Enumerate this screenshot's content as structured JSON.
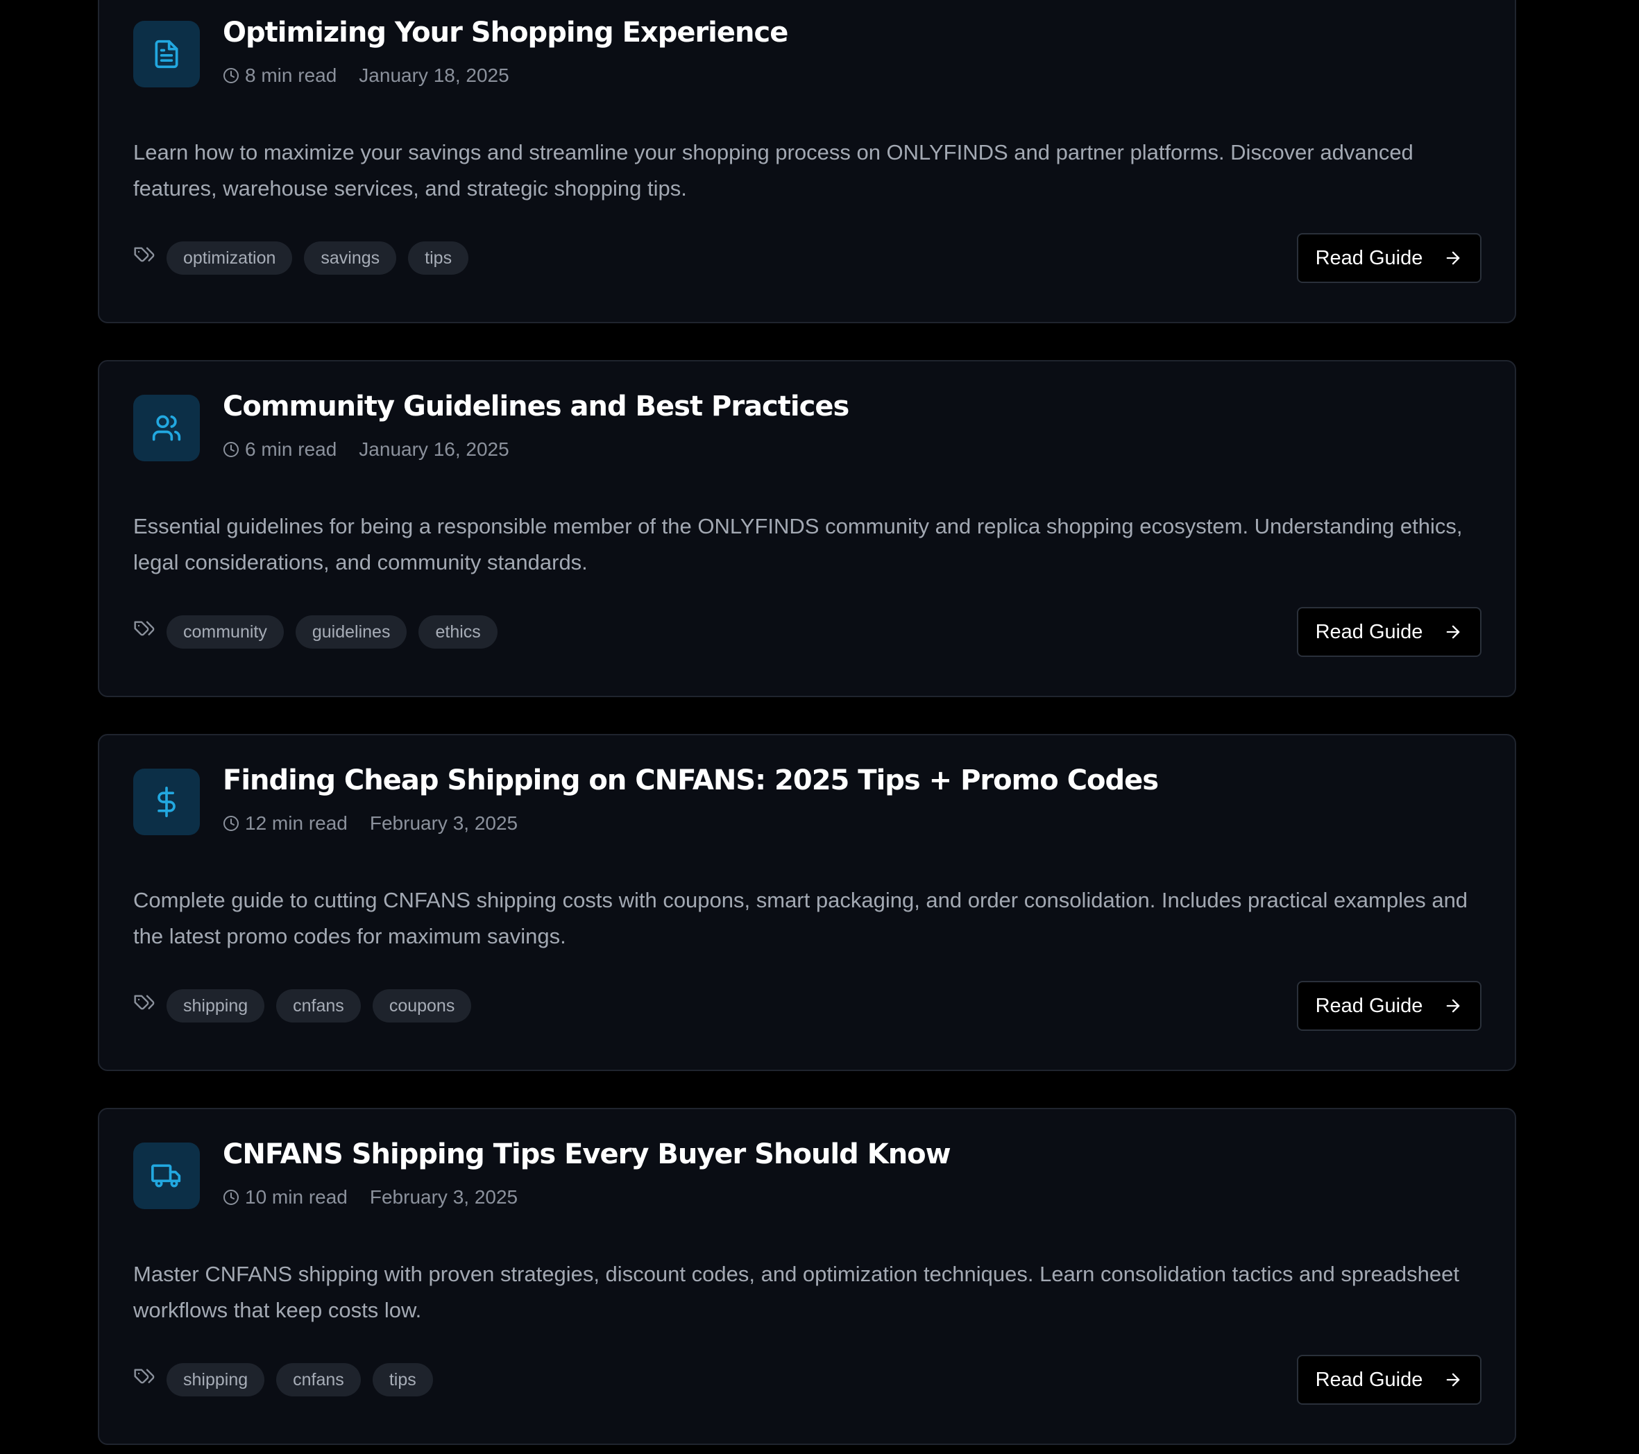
{
  "theme": {
    "accent": "#22a8e0",
    "card_bg": "#0a0d14",
    "page_bg": "#000000"
  },
  "guides": [
    {
      "icon": "document-icon",
      "title": "Optimizing Your Shopping Experience",
      "read_time": "8 min read",
      "date": "January 18, 2025",
      "description": "Learn how to maximize your savings and streamline your shopping process on ONLYFINDS and partner platforms. Discover advanced features, warehouse services, and strategic shopping tips.",
      "tags": [
        "optimization",
        "savings",
        "tips"
      ],
      "button_label": "Read Guide"
    },
    {
      "icon": "users-icon",
      "title": "Community Guidelines and Best Practices",
      "read_time": "6 min read",
      "date": "January 16, 2025",
      "description": "Essential guidelines for being a responsible member of the ONLYFINDS community and replica shopping ecosystem. Understanding ethics, legal considerations, and community standards.",
      "tags": [
        "community",
        "guidelines",
        "ethics"
      ],
      "button_label": "Read Guide"
    },
    {
      "icon": "dollar-icon",
      "title": "Finding Cheap Shipping on CNFANS: 2025 Tips + Promo Codes",
      "read_time": "12 min read",
      "date": "February 3, 2025",
      "description": "Complete guide to cutting CNFANS shipping costs with coupons, smart packaging, and order consolidation. Includes practical examples and the latest promo codes for maximum savings.",
      "tags": [
        "shipping",
        "cnfans",
        "coupons"
      ],
      "button_label": "Read Guide"
    },
    {
      "icon": "truck-icon",
      "title": "CNFANS Shipping Tips Every Buyer Should Know",
      "read_time": "10 min read",
      "date": "February 3, 2025",
      "description": "Master CNFANS shipping with proven strategies, discount codes, and optimization techniques. Learn consolidation tactics and spreadsheet workflows that keep costs low.",
      "tags": [
        "shipping",
        "cnfans",
        "tips"
      ],
      "button_label": "Read Guide"
    }
  ]
}
